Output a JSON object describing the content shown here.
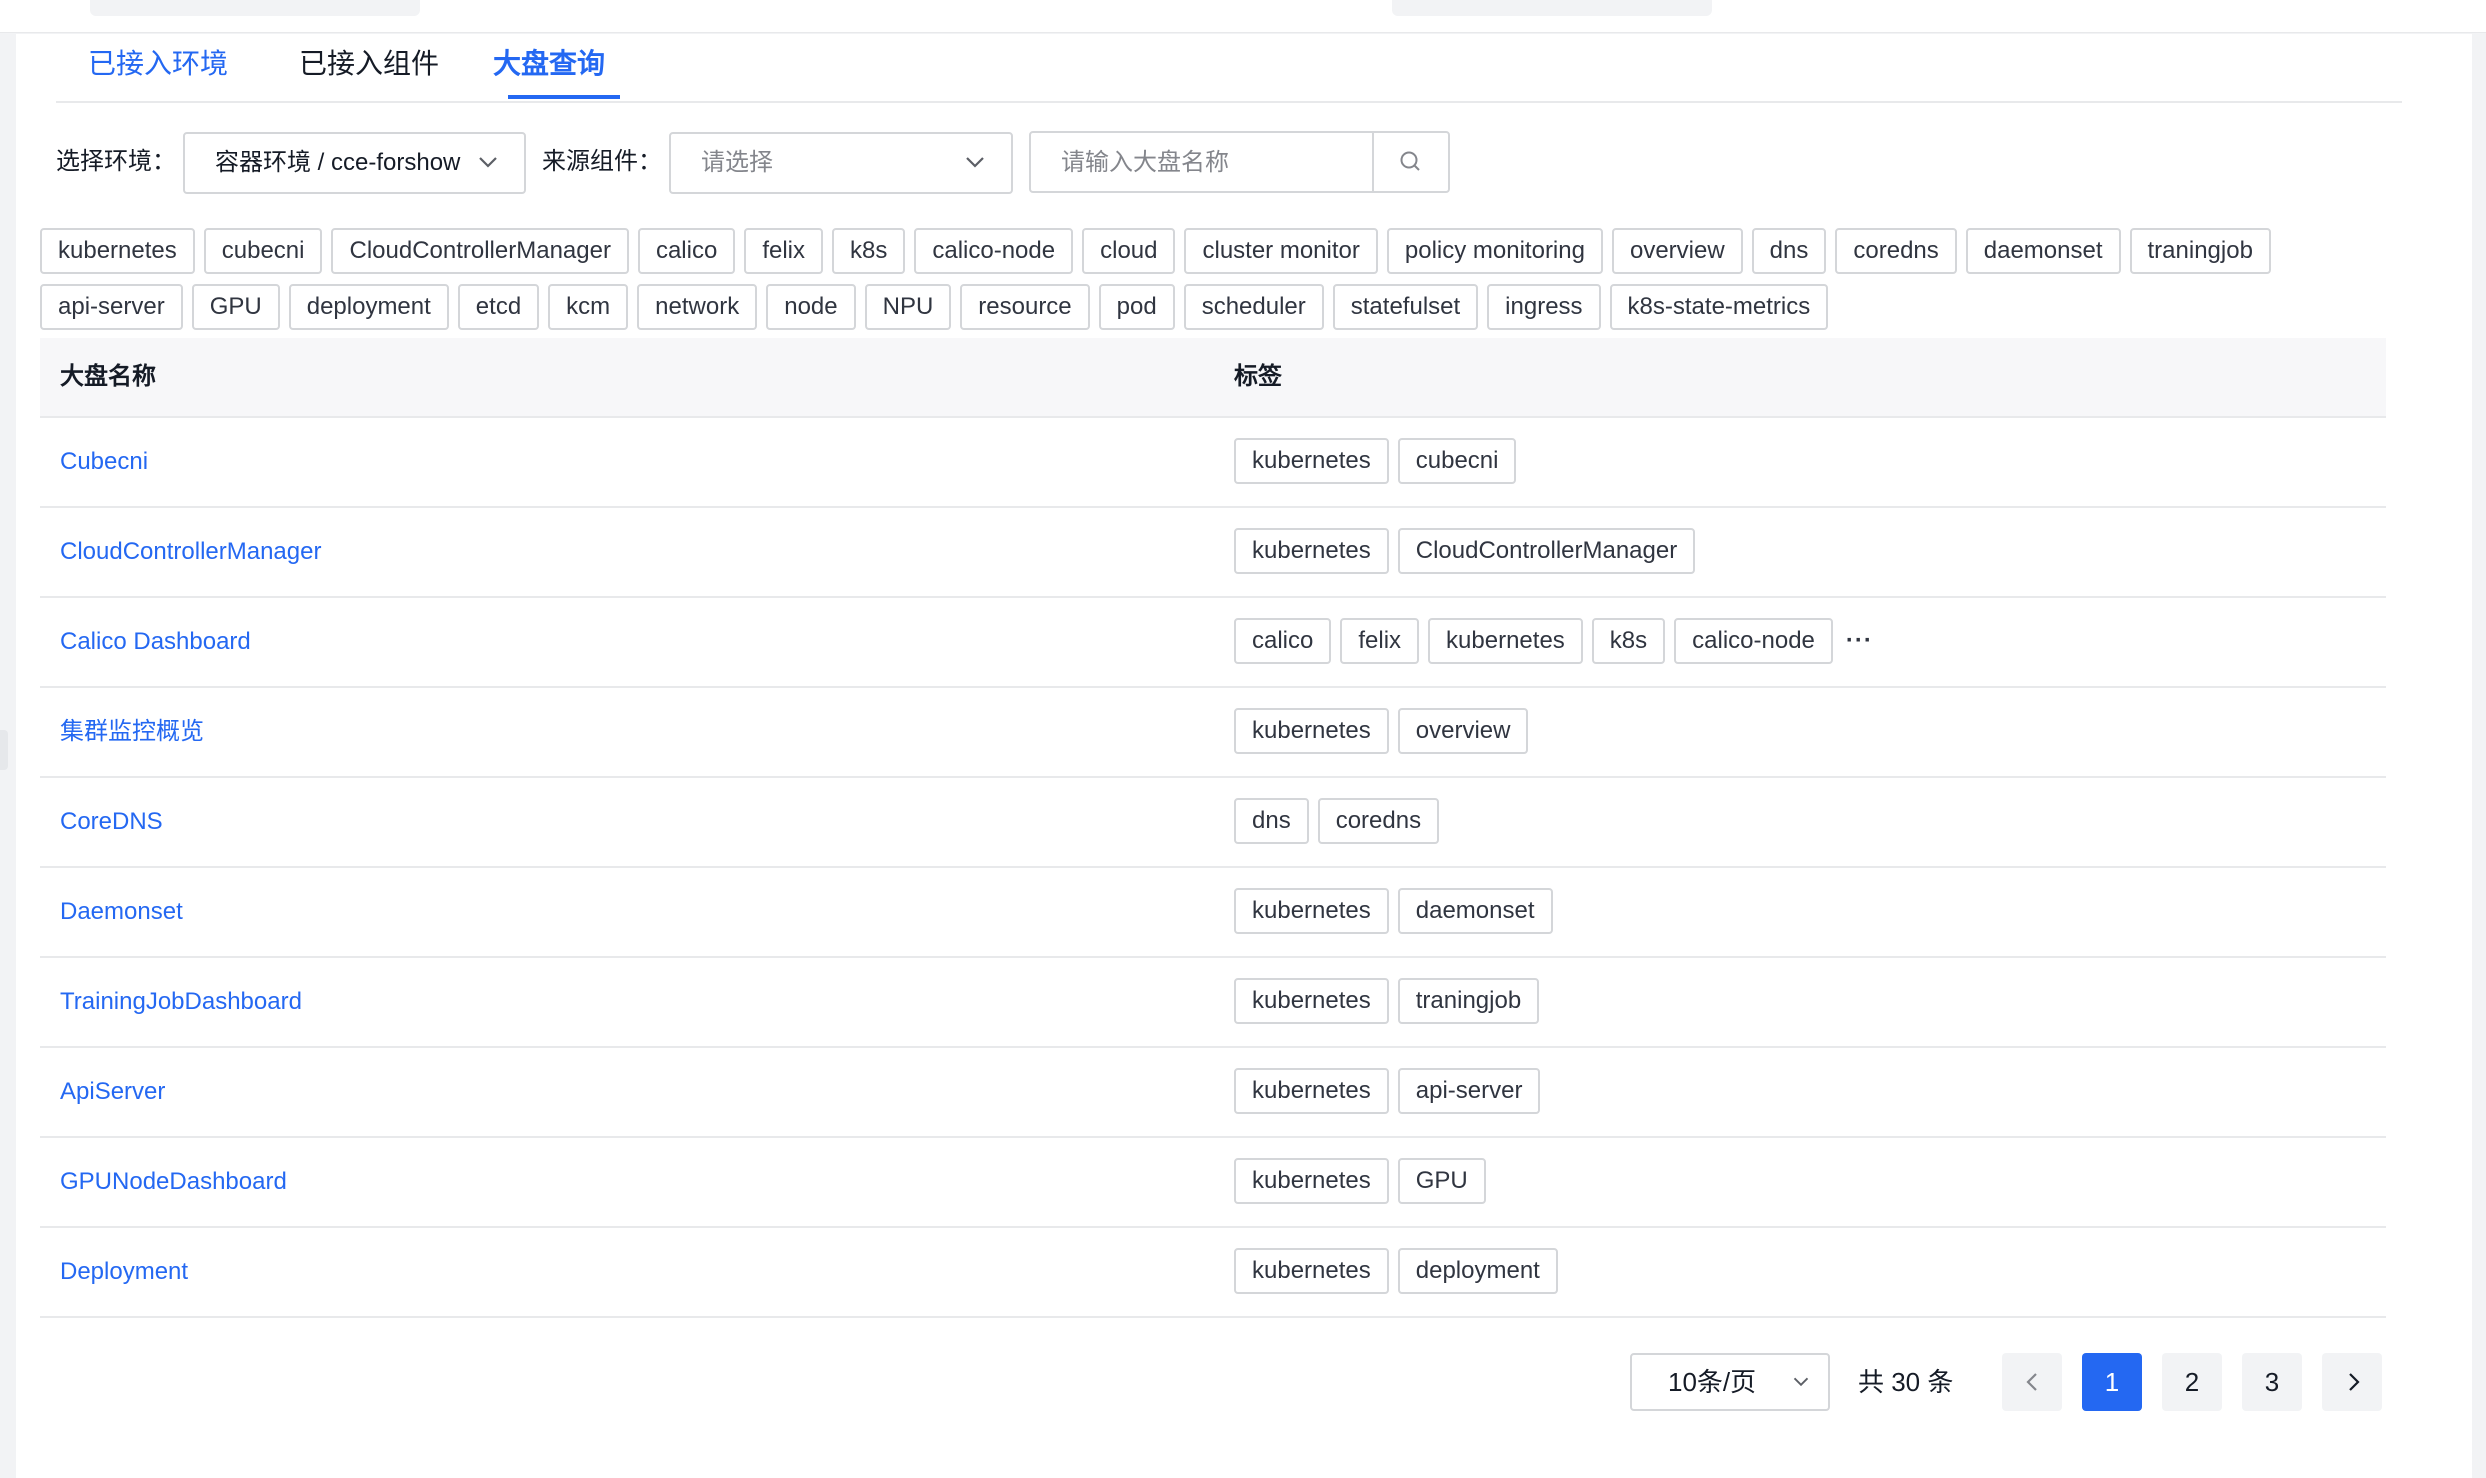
{
  "tabs": [
    {
      "label": "已接入环境"
    },
    {
      "label": "已接入组件"
    },
    {
      "label": "大盘查询"
    }
  ],
  "filters": {
    "env_label": "选择环境：",
    "env_value": "容器环境 / cce-forshow",
    "source_label": "来源组件：",
    "source_placeholder": "请选择",
    "search_placeholder": "请输入大盘名称"
  },
  "tag_filter_rows": [
    [
      "kubernetes",
      "cubecni",
      "CloudControllerManager",
      "calico",
      "felix",
      "k8s",
      "calico-node",
      "cloud",
      "cluster monitor",
      "policy monitoring",
      "overview",
      "dns",
      "coredns",
      "daemonset",
      "traningjob"
    ],
    [
      "api-server",
      "GPU",
      "deployment",
      "etcd",
      "kcm",
      "network",
      "node",
      "NPU",
      "resource",
      "pod",
      "scheduler",
      "statefulset",
      "ingress",
      "k8s-state-metrics"
    ]
  ],
  "table": {
    "headers": {
      "name": "大盘名称",
      "tags": "标签"
    },
    "rows": [
      {
        "name": "Cubecni",
        "tags": [
          "kubernetes",
          "cubecni"
        ]
      },
      {
        "name": "CloudControllerManager",
        "tags": [
          "kubernetes",
          "CloudControllerManager"
        ]
      },
      {
        "name": "Calico Dashboard",
        "tags": [
          "calico",
          "felix",
          "kubernetes",
          "k8s",
          "calico-node"
        ],
        "more": "···"
      },
      {
        "name": "集群监控概览",
        "tags": [
          "kubernetes",
          "overview"
        ]
      },
      {
        "name": "CoreDNS",
        "tags": [
          "dns",
          "coredns"
        ]
      },
      {
        "name": "Daemonset",
        "tags": [
          "kubernetes",
          "daemonset"
        ]
      },
      {
        "name": "TrainingJobDashboard",
        "tags": [
          "kubernetes",
          "traningjob"
        ]
      },
      {
        "name": "ApiServer",
        "tags": [
          "kubernetes",
          "api-server"
        ]
      },
      {
        "name": "GPUNodeDashboard",
        "tags": [
          "kubernetes",
          "GPU"
        ]
      },
      {
        "name": "Deployment",
        "tags": [
          "kubernetes",
          "deployment"
        ]
      }
    ]
  },
  "pagination": {
    "page_size": "10条/页",
    "total": "共 30 条",
    "pages": [
      "1",
      "2",
      "3"
    ],
    "current": "1"
  },
  "colors": {
    "accent": "#2468f2",
    "border": "#d4d6d9"
  }
}
